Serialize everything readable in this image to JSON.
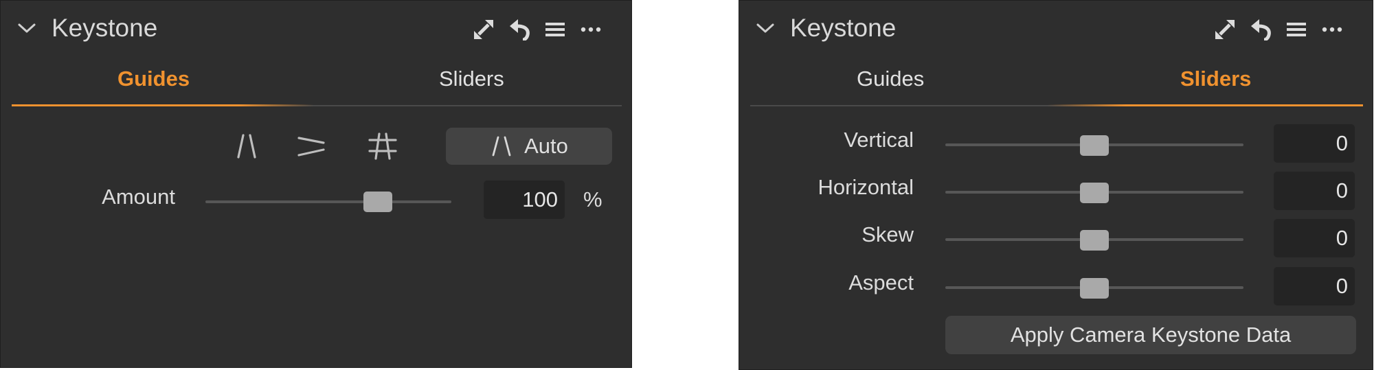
{
  "left_panel": {
    "title": "Keystone",
    "header_icons": [
      "expand-icon",
      "reset-icon",
      "presets-menu-icon",
      "more-icon"
    ],
    "tabs": [
      {
        "label": "Guides",
        "active": true
      },
      {
        "label": "Sliders",
        "active": false
      }
    ],
    "guide_tools": [
      "vertical-keystone-icon",
      "horizontal-keystone-icon",
      "full-keystone-icon"
    ],
    "auto_button": {
      "label": "Auto",
      "icon": "vertical-keystone-icon"
    },
    "amount": {
      "label": "Amount",
      "value": "100",
      "unit": "%",
      "position": 0.7
    }
  },
  "right_panel": {
    "title": "Keystone",
    "header_icons": [
      "expand-icon",
      "reset-icon",
      "presets-menu-icon",
      "more-icon"
    ],
    "tabs": [
      {
        "label": "Guides",
        "active": false
      },
      {
        "label": "Sliders",
        "active": true
      }
    ],
    "sliders": [
      {
        "label": "Vertical",
        "value": "0",
        "position": 0.5
      },
      {
        "label": "Horizontal",
        "value": "0",
        "position": 0.5
      },
      {
        "label": "Skew",
        "value": "0",
        "position": 0.5
      },
      {
        "label": "Aspect",
        "value": "0",
        "position": 0.5
      }
    ],
    "apply_button": "Apply Camera Keystone Data"
  },
  "colors": {
    "panel_bg": "#2e2e2e",
    "accent": "#f0922f",
    "text": "#dcdcdc",
    "value_box": "#242424",
    "slider_thumb": "#a9a9a9",
    "slider_track": "#575757"
  }
}
